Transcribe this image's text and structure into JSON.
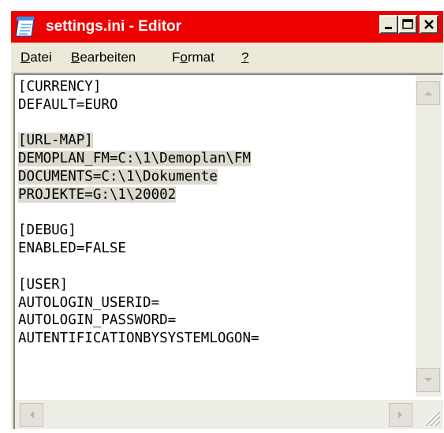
{
  "window": {
    "title": "settings.ini - Editor",
    "title_bar_color": "#ee0000",
    "icon": "notepad-icon"
  },
  "caption_buttons": {
    "minimize_icon": "minimize-icon",
    "maximize_icon": "maximize-icon",
    "close_icon": "close-icon"
  },
  "menu": {
    "items": [
      {
        "underline": "D",
        "rest": "atei"
      },
      {
        "underline": "B",
        "rest": "earbeiten"
      },
      {
        "pre": "F",
        "underline": "o",
        "rest": "rmat"
      },
      {
        "underline": "?",
        "rest": ""
      }
    ]
  },
  "editor": {
    "highlight_color": "#dcd9cf",
    "lines": [
      {
        "text": "[CURRENCY]",
        "highlighted": false
      },
      {
        "text": "DEFAULT=EURO",
        "highlighted": false
      },
      {
        "text": "",
        "highlighted": false
      },
      {
        "text": "[URL-MAP]",
        "highlighted": true
      },
      {
        "text": "DEMOPLAN_FM=C:\\1\\Demoplan\\FM",
        "highlighted": true
      },
      {
        "text": "DOCUMENTS=C:\\1\\Dokumente",
        "highlighted": true
      },
      {
        "text": "PROJEKTE=G:\\1\\20002",
        "highlighted": true
      },
      {
        "text": "",
        "highlighted": false
      },
      {
        "text": "[DEBUG]",
        "highlighted": false
      },
      {
        "text": "ENABLED=FALSE",
        "highlighted": false
      },
      {
        "text": "",
        "highlighted": false
      },
      {
        "text": "[USER]",
        "highlighted": false
      },
      {
        "text": "AUTOLOGIN_USERID=",
        "highlighted": false
      },
      {
        "text": "AUTOLOGIN_PASSWORD=",
        "highlighted": false
      },
      {
        "text": "AUTENTIFICATIONBYSYSTEMLOGON=",
        "highlighted": false
      }
    ]
  },
  "scrollbars": {
    "up_icon": "scroll-up-arrow-icon",
    "down_icon": "scroll-down-arrow-icon",
    "left_icon": "scroll-left-arrow-icon",
    "right_icon": "scroll-right-arrow-icon",
    "grip_icon": "resize-grip-icon"
  }
}
